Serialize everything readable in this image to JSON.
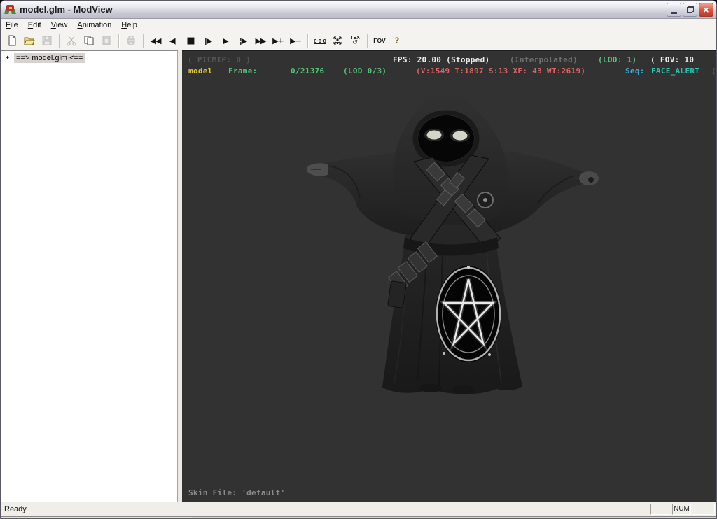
{
  "titlebar": {
    "title": "model.glm - ModView"
  },
  "menu": {
    "items": [
      {
        "key": "F",
        "rest": "ile"
      },
      {
        "key": "E",
        "rest": "dit"
      },
      {
        "key": "V",
        "rest": "iew"
      },
      {
        "key": "A",
        "rest": "nimation"
      },
      {
        "key": "H",
        "rest": "elp"
      }
    ]
  },
  "toolbar": {
    "icons": {
      "rewind": "◀◀",
      "step_back": "◀|",
      "stop": "■",
      "step_forward": "|▶",
      "play": "▶",
      "play_marked": "¦▶",
      "fast_forward": "▶▶",
      "speed_up": "▶+",
      "speed_down": "▶−"
    },
    "origin_label": "0·0·0",
    "tex_label": "TEX",
    "tex_arrow": "↺",
    "fov_label": "FOV",
    "help_label": "?"
  },
  "tree": {
    "expand_glyph": "+",
    "root_label": "==> model.glm <=="
  },
  "viewport": {
    "hud_top": {
      "picmip": "( PICMIP: 0 )",
      "fps": "FPS: 20.00 (Stopped)",
      "interpolated": "(Interpolated)",
      "lod": "(LOD: 1)",
      "fov": "( FOV: 10"
    },
    "hud_info": {
      "model_name": "model",
      "frame_label": "Frame:",
      "frame_value": "0/21376",
      "lod": "(LOD 0/3)",
      "stats": "(V:1549 T:1897 S:13 XF: 43 WT:2619)",
      "seq_label": "Seq:",
      "seq_value": "FACE_ALERT",
      "trailing": "("
    },
    "skin_file": "Skin File: 'default'"
  },
  "statusbar": {
    "message": "Ready",
    "num_indicator": "NUM"
  },
  "colors": {
    "viewport_bg": "#323232",
    "hud_green": "#55c478",
    "hud_yellow": "#d9c83a",
    "hud_red": "#d96565",
    "hud_cyan": "#3fb0d9",
    "hud_teal": "#2cc4ad",
    "hud_white": "#ededed",
    "hud_dim": "#575757",
    "close_button_red": "#d9533c"
  }
}
